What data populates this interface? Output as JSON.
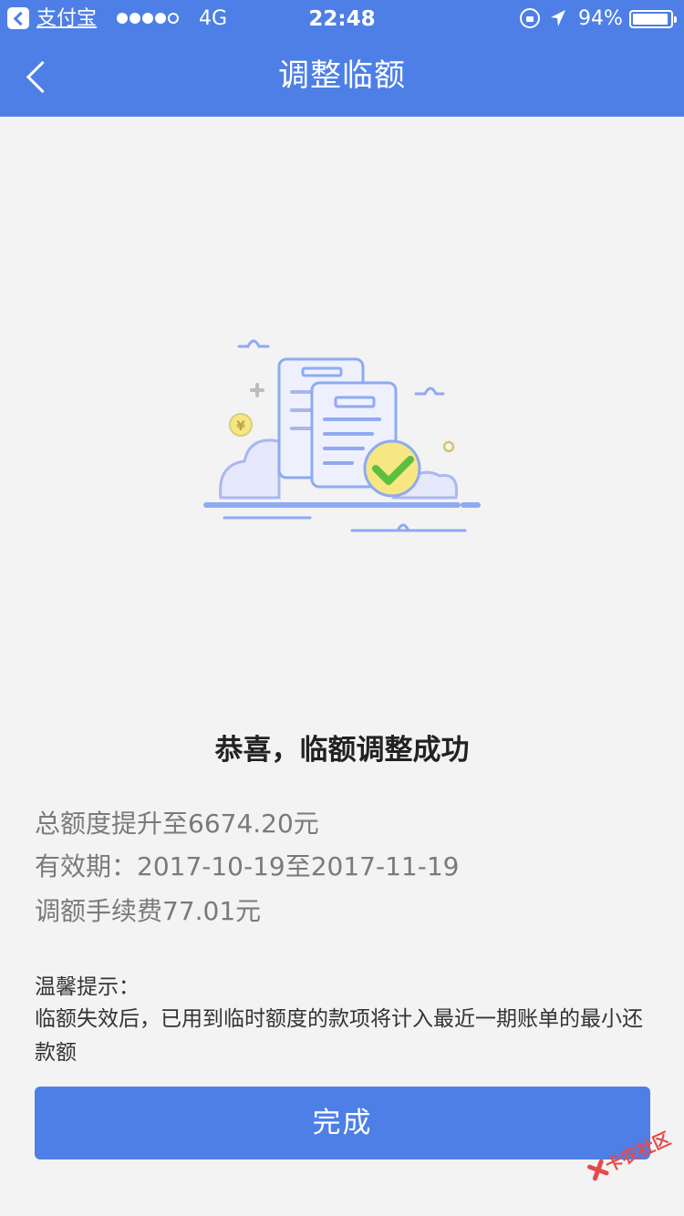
{
  "status_bar": {
    "app_name": "支付宝",
    "network": "4G",
    "time": "22:48",
    "battery": "94%"
  },
  "nav": {
    "title": "调整临额",
    "back_icon": "chevron-left-icon"
  },
  "result": {
    "title": "恭喜，临额调整成功",
    "total_limit": "总额度提升至6674.20元",
    "validity": "有效期：2017-10-19至2017-11-19",
    "fee": "调额手续费77.01元"
  },
  "tip": {
    "heading": "温馨提示：",
    "body": "临额失效后，已用到临时额度的款项将计入最近一期账单的最小还款额"
  },
  "actions": {
    "done_label": "完成"
  },
  "watermark": {
    "text": "卡农社区"
  },
  "colors": {
    "primary": "#4d7fe6",
    "background": "#f3f3f3",
    "check_green": "#5cbe3f",
    "check_yellow": "#f9e87a"
  }
}
